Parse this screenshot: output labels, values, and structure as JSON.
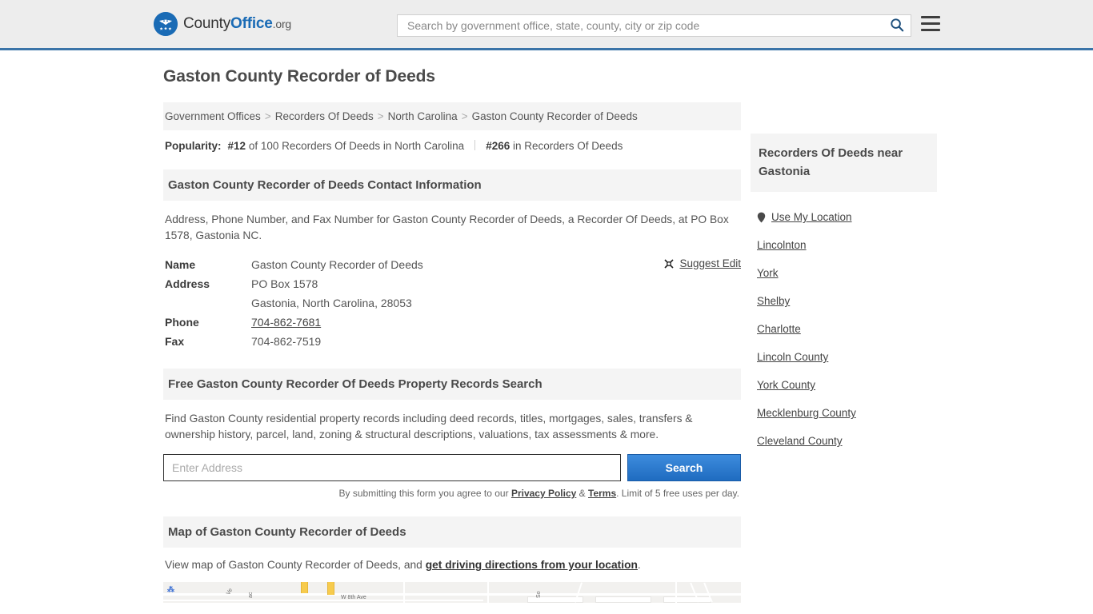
{
  "header": {
    "logo": {
      "text_county": "County",
      "text_office": "Office",
      "text_tld": ".org",
      "icon": "eagle-shield-logo"
    },
    "search_placeholder": "Search by government office, state, county, city or zip code",
    "search_value": "",
    "search_icon": "magnifier-icon",
    "menu_icon": "hamburger-menu-icon"
  },
  "page": {
    "title": "Gaston County Recorder of Deeds"
  },
  "breadcrumb": {
    "items": [
      {
        "label": "Government Offices",
        "link": true
      },
      {
        "label": "Recorders Of Deeds",
        "link": true
      },
      {
        "label": "North Carolina",
        "link": true
      },
      {
        "label": "Gaston County Recorder of Deeds",
        "link": false
      }
    ],
    "separator": ">"
  },
  "popularity": {
    "label": "Popularity:",
    "rank_state": "#12",
    "rank_state_suffix": "of 100 Recorders Of Deeds in North Carolina",
    "rank_national": "#266",
    "rank_national_suffix": "in Recorders Of Deeds"
  },
  "contact": {
    "section_title": "Gaston County Recorder of Deeds Contact Information",
    "description": "Address, Phone Number, and Fax Number for Gaston County Recorder of Deeds, a Recorder Of Deeds, at PO Box 1578, Gastonia NC.",
    "suggest_edit_label": "Suggest Edit",
    "suggest_edit_icon": "edit-pencil-icon",
    "rows": [
      {
        "key": "Name",
        "value": "Gaston County Recorder of Deeds"
      },
      {
        "key": "Address",
        "value": "PO Box 1578"
      },
      {
        "key": "",
        "value": "Gastonia, North Carolina, 28053"
      },
      {
        "key": "Phone",
        "value": "704-862-7681"
      },
      {
        "key": "Fax",
        "value": "704-862-7519"
      }
    ]
  },
  "property_search": {
    "section_title": "Free Gaston County Recorder Of Deeds Property Records Search",
    "description": "Find Gaston County residential property records including deed records, titles, mortgages, sales, transfers & ownership history, parcel, land, zoning & structural descriptions, valuations, tax assessments & more.",
    "input_placeholder": "Enter Address",
    "input_value": "",
    "button_label": "Search",
    "note_prefix": "By submitting this form you agree to our ",
    "note_privacy": "Privacy Policy",
    "note_amp": " & ",
    "note_terms": "Terms",
    "note_suffix": ". Limit of 5 free uses per day."
  },
  "map": {
    "section_title": "Map of Gaston County Recorder of Deeds",
    "description_prefix": "View map of Gaston County Recorder of Deeds, and ",
    "directions_link": "get driving directions from your location",
    "description_suffix": ".",
    "labels": [
      "W 8th Ave",
      "Ve",
      "ac",
      "So"
    ]
  },
  "sidebar": {
    "heading": "Recorders Of Deeds near Gastonia",
    "use_my_location": {
      "label": "Use My Location",
      "icon": "map-pin-icon"
    },
    "links": [
      "Lincolnton",
      "York",
      "Shelby",
      "Charlotte",
      "Lincoln County",
      "York County",
      "Mecklenburg County",
      "Cleveland County"
    ]
  },
  "colors": {
    "brand_blue": "#1a6bb5",
    "header_border": "#3b74a8",
    "header_bg": "#ededed",
    "section_bg": "#f4f4f4",
    "button_blue": "#2f7fd6",
    "text": "#444444",
    "map_road_yellow": "#f7cb4d"
  }
}
